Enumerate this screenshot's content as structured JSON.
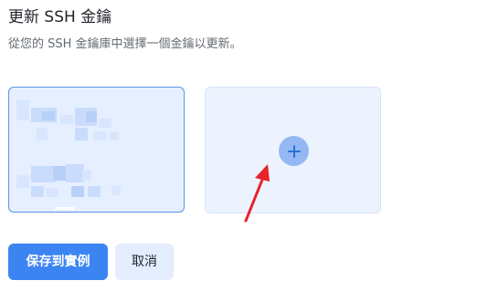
{
  "dialog": {
    "title": "更新 SSH 金鑰",
    "description": "從您的 SSH 金鑰庫中選擇一個金鑰以更新。"
  },
  "key_cards": {
    "selected_key": {
      "state": "selected"
    },
    "add_new": {
      "icon": "plus-icon"
    }
  },
  "annotation": {
    "arrow_color": "#e8212b"
  },
  "actions": {
    "save_label": "保存到實例",
    "cancel_label": "取消"
  },
  "colors": {
    "primary": "#3c84f2",
    "selected_border": "#5b94e6"
  }
}
